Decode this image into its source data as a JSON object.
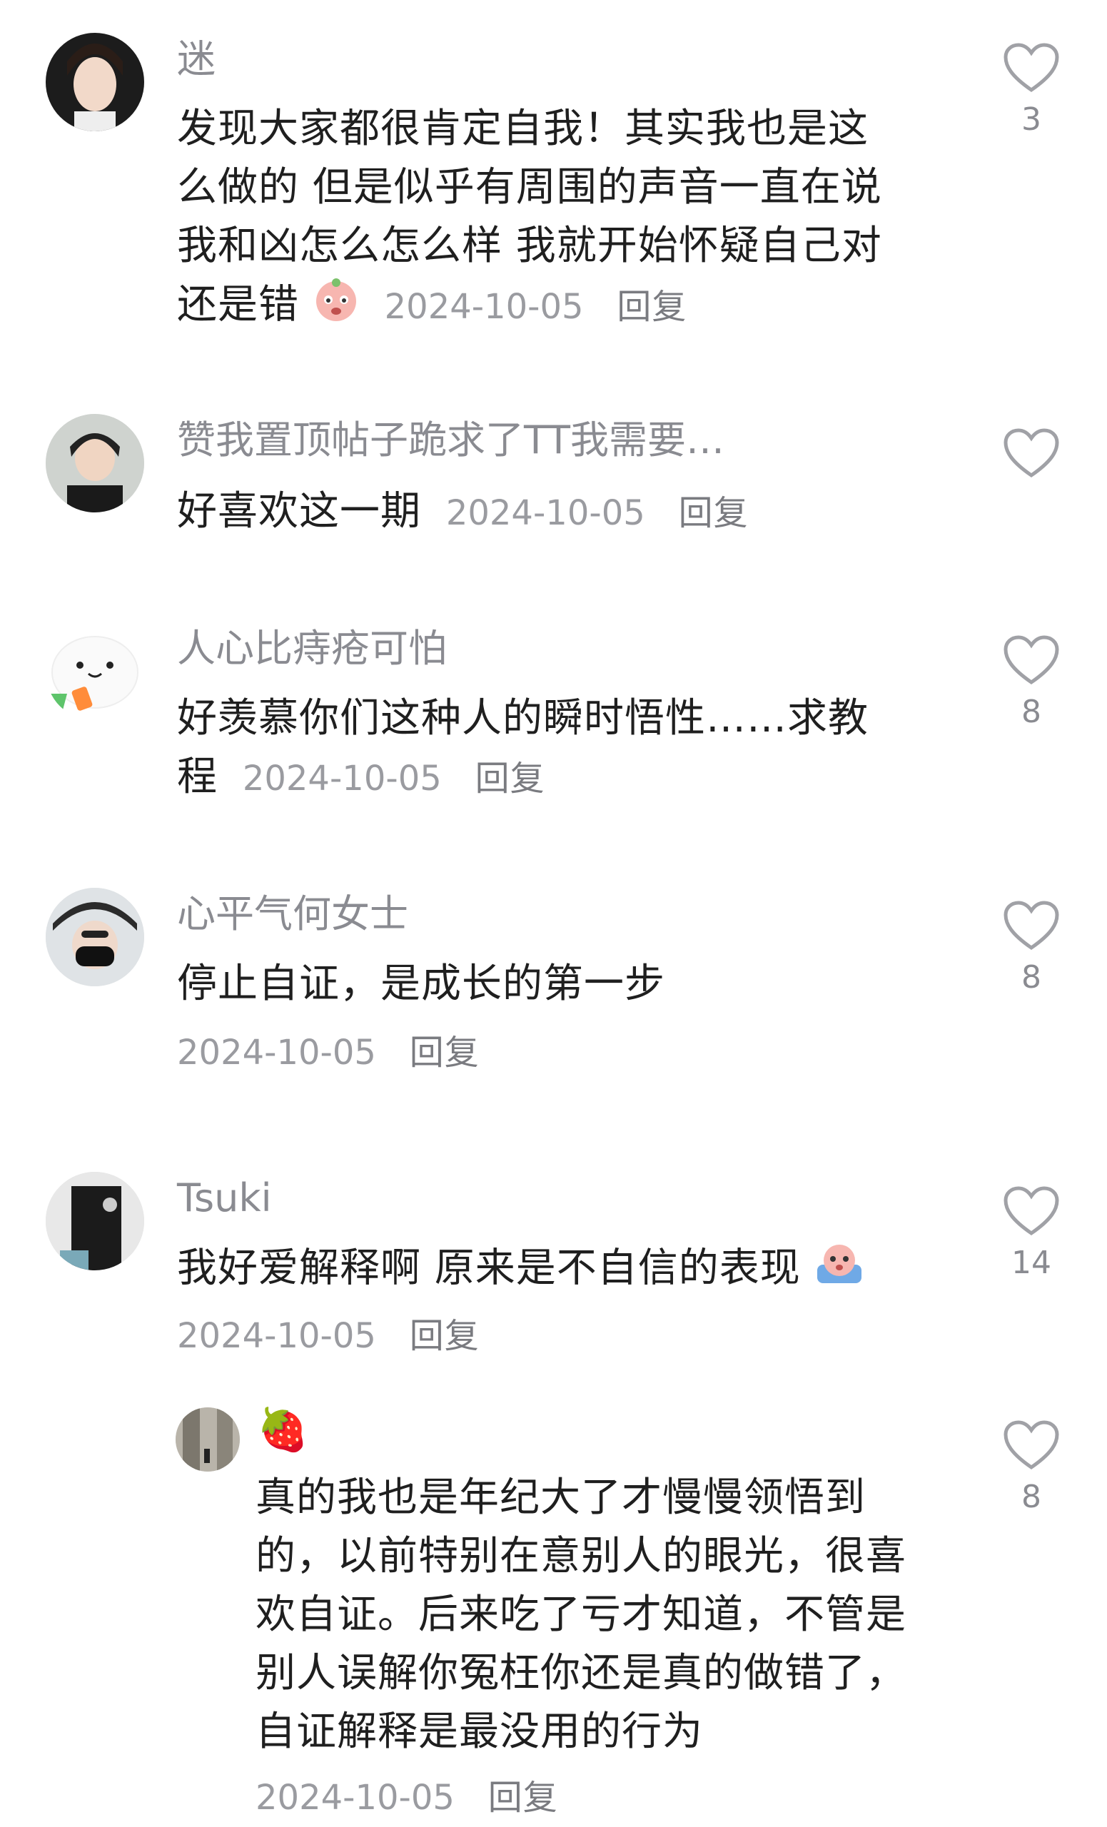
{
  "comments": [
    {
      "username": "迷",
      "lines": [
        "发现大家都很肯定自我！其实我也是这",
        "么做的 但是似乎有周围的声音一直在说",
        "我和凶怎么怎么样 我就开始怀疑自己对",
        "还是错"
      ],
      "date": "2024-10-05",
      "reply": "回复",
      "likes": "3"
    },
    {
      "username": "赞我置顶帖子跪求了TT我需要…",
      "lines": [
        "好喜欢这一期"
      ],
      "date": "2024-10-05",
      "reply": "回复",
      "likes": ""
    },
    {
      "username": "人心比痔疮可怕",
      "lines": [
        "好羡慕你们这种人的瞬时悟性……求教",
        "程"
      ],
      "date": "2024-10-05",
      "reply": "回复",
      "likes": "8"
    },
    {
      "username": "心平气何女士",
      "lines": [
        "停止自证，是成长的第一步"
      ],
      "date": "2024-10-05",
      "reply": "回复",
      "likes": "8"
    },
    {
      "username": "Tsuki",
      "lines": [
        "我好爱解释啊 原来是不自信的表现"
      ],
      "date": "2024-10-05",
      "reply": "回复",
      "likes": "14"
    },
    {
      "username": "🍓",
      "lines": [
        "真的我也是年纪大了才慢慢领悟到",
        "的，以前特别在意别人的眼光，很喜",
        "欢自证。后来吃了亏才知道，不管是",
        "别人误解你冤枉你还是真的做错了，",
        "自证解释是最没用的行为"
      ],
      "date": "2024-10-05",
      "reply": "回复",
      "likes": "8"
    }
  ],
  "icons": {
    "like": "heart-outline-icon",
    "emoji_1": "crying-face-emoji",
    "emoji_2": "sweating-face-emoji"
  },
  "colors": {
    "text": "#1f1f1f",
    "muted": "#8a8b91",
    "heart": "#a0a1a6"
  }
}
